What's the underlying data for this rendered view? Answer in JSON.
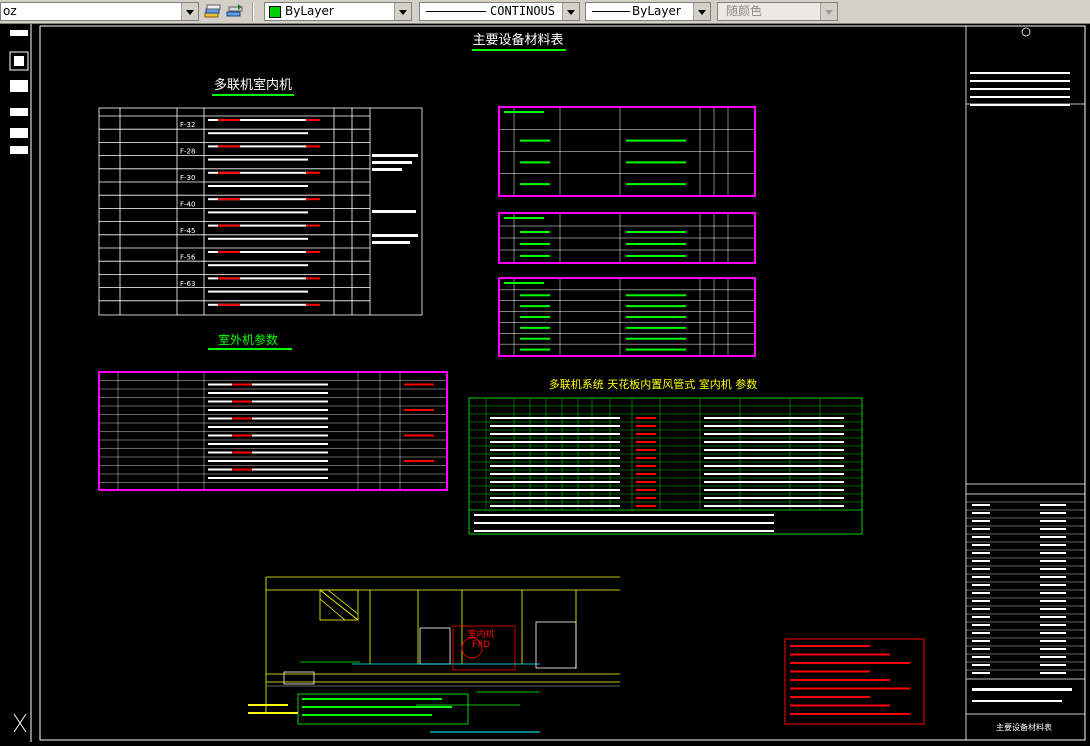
{
  "toolbar": {
    "layer_value": "oz",
    "color_value": "ByLayer",
    "linetype_value": "CONTINOUS",
    "lineweight_value": "ByLayer",
    "plotstyle_value": "随颜色"
  },
  "drawing": {
    "sheet_title": "主要设备材料表",
    "indoor_title": "多联机室内机",
    "outdoor_title": "室外机参数",
    "duct_title": "多联机系统  天花板内置风管式  室内机  参数",
    "detail_label": "室内机",
    "detail_code": "FXD",
    "footer_title": "主要设备材料表"
  },
  "indoor_table": {
    "models": [
      "F-32",
      "F-28",
      "F-30",
      "F-40",
      "F-45",
      "F-56",
      "F-63"
    ]
  },
  "colors": {
    "white_line": "#ffffff",
    "magenta_frame": "#ff00ff",
    "green_text": "#00ff00",
    "yellow_line": "#ffff00",
    "red_text": "#ff0000",
    "cyan_line": "#00ffff"
  }
}
